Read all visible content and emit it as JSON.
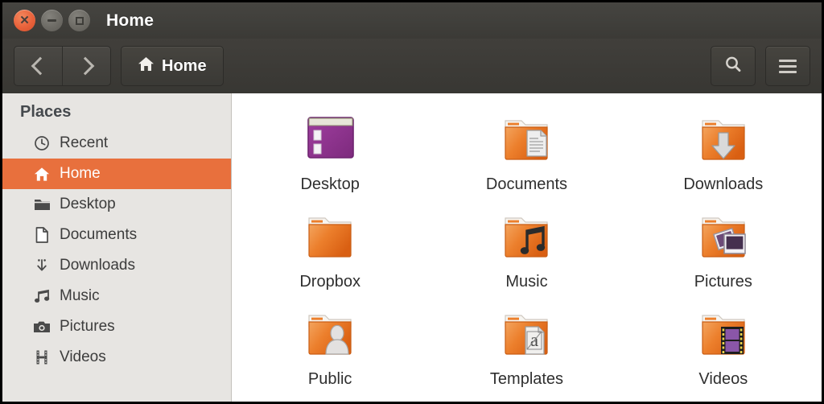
{
  "window": {
    "title": "Home",
    "controls": [
      {
        "name": "close-button",
        "glyph": "x"
      },
      {
        "name": "minimize-button",
        "glyph": "minimize"
      },
      {
        "name": "maximize-button",
        "glyph": "maximize"
      }
    ]
  },
  "toolbar": {
    "back_label": "Back",
    "forward_label": "Forward",
    "path_label": "Home",
    "path_icon": "home-icon",
    "search_icon": "search-icon",
    "menu_icon": "hamburger-menu-icon"
  },
  "sidebar": {
    "heading": "Places",
    "items": [
      {
        "label": "Recent",
        "icon": "clock-icon",
        "active": false
      },
      {
        "label": "Home",
        "icon": "home-icon",
        "active": true
      },
      {
        "label": "Desktop",
        "icon": "folder-icon",
        "active": false
      },
      {
        "label": "Documents",
        "icon": "document-icon",
        "active": false
      },
      {
        "label": "Downloads",
        "icon": "download-arrow-icon",
        "active": false
      },
      {
        "label": "Music",
        "icon": "music-note-icon",
        "active": false
      },
      {
        "label": "Pictures",
        "icon": "camera-icon",
        "active": false
      },
      {
        "label": "Videos",
        "icon": "film-strip-icon",
        "active": false
      }
    ]
  },
  "content": {
    "view": "icon-grid",
    "columns": 3,
    "items": [
      {
        "label": "Desktop",
        "icon": "desktop-window-icon"
      },
      {
        "label": "Documents",
        "icon": "folder-documents-icon"
      },
      {
        "label": "Downloads",
        "icon": "folder-downloads-icon"
      },
      {
        "label": "Dropbox",
        "icon": "folder-plain-icon"
      },
      {
        "label": "Music",
        "icon": "folder-music-icon"
      },
      {
        "label": "Pictures",
        "icon": "folder-pictures-icon"
      },
      {
        "label": "Public",
        "icon": "folder-public-icon"
      },
      {
        "label": "Templates",
        "icon": "folder-templates-icon"
      },
      {
        "label": "Videos",
        "icon": "folder-videos-icon"
      }
    ]
  },
  "colors": {
    "accent_orange": "#e8703d",
    "titlebar": "#3c3b37",
    "sidebar_bg": "#e7e5e2",
    "content_bg": "#ffffff",
    "folder_orange": "#e8701f",
    "desktop_purple": "#9b3f9b"
  }
}
